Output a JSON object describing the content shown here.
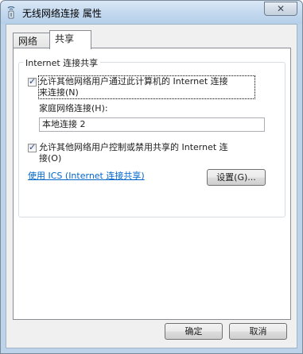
{
  "window": {
    "title": "无线网络连接 属性",
    "close_symbol": "✕",
    "icon": "network-adapter-icon"
  },
  "tabs": [
    {
      "label": "网络"
    },
    {
      "label": "共享"
    }
  ],
  "sharing": {
    "group_title": "Internet 连接共享",
    "allow_share": {
      "checked": true,
      "line1": "允许其他网络用户通过此计算机的 Internet 连接",
      "line2": "来连接(N)"
    },
    "home_connection": {
      "label": "家庭网络连接(H):",
      "value": "本地连接 2"
    },
    "allow_control": {
      "checked": true,
      "line1": "允许其他网络用户控制或禁用共享的 Internet 连",
      "line2": "接(O)"
    },
    "ics_link": "使用 ICS (Internet 连接共享)",
    "settings_button": "设置(G)..."
  },
  "footer": {
    "ok_label": "确定",
    "cancel_label": "取消"
  }
}
